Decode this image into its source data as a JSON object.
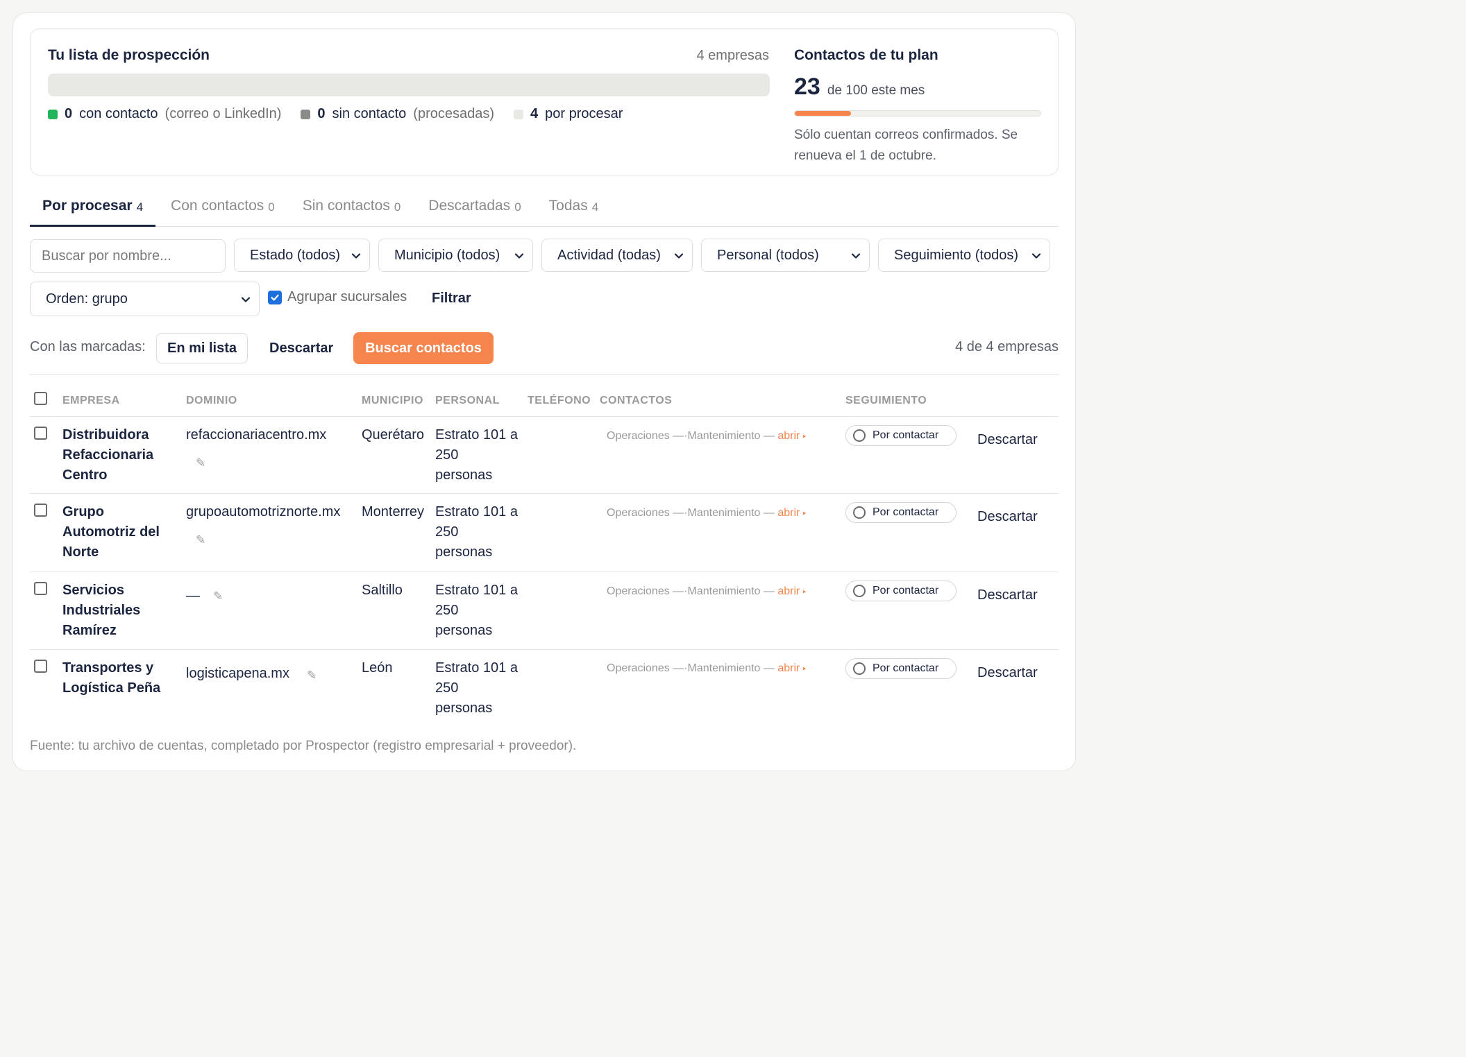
{
  "summary": {
    "title": "Tu lista de prospección",
    "count_text": "4 empresas",
    "progress_fraction": 0.0,
    "legend": [
      {
        "num": "0",
        "label": "con contacto",
        "note": "(correo o LinkedIn)",
        "color": "#22b55a"
      },
      {
        "num": "0",
        "label": "sin contacto",
        "note": "(procesadas)",
        "color": "#8a8a86"
      },
      {
        "num": "4",
        "label": "por procesar",
        "note": "",
        "color": "#e8e8e4"
      }
    ]
  },
  "plan": {
    "title": "Contactos de tu plan",
    "used": "23",
    "of_text": "de 100 este mes",
    "used_fraction": 0.23,
    "note": "Sólo cuentan correos confirmados. Se renueva el 1 de octubre."
  },
  "tabs": [
    {
      "label": "Por procesar",
      "count": "4",
      "active": true
    },
    {
      "label": "Con contactos",
      "count": "0",
      "active": false
    },
    {
      "label": "Sin contactos",
      "count": "0",
      "active": false
    },
    {
      "label": "Descartadas",
      "count": "0",
      "active": false
    },
    {
      "label": "Todas",
      "count": "4",
      "active": false
    }
  ],
  "filters": {
    "search_placeholder": "Buscar por nombre...",
    "estado": "Estado (todos)",
    "municipio": "Municipio (todos)",
    "actividad": "Actividad (todas)",
    "personal": "Personal (todos)",
    "seguimiento": "Seguimiento (todos)",
    "orden": "Orden: grupo",
    "agrupar_label": "Agrupar sucursales",
    "agrupar_checked": true,
    "filtrar_label": "Filtrar"
  },
  "bulk": {
    "label": "Con las marcadas:",
    "en_mi_lista": "En mi lista",
    "descartar": "Descartar",
    "buscar_contactos": "Buscar contactos",
    "result_count": "4 de 4 empresas"
  },
  "table": {
    "headers": {
      "empresa": "EMPRESA",
      "dominio": "DOMINIO",
      "municipio": "MUNICIPIO",
      "personal": "PERSONAL",
      "telefono": "TELÉFONO",
      "contactos": "CONTACTOS",
      "seguimiento": "SEGUIMIENTO"
    },
    "rows": [
      {
        "empresa": "Distribuidora Refaccionaria Centro",
        "dominio": "refaccionariacentro.mx",
        "municipio": "Querétaro",
        "personal": "Estrato 101 a 250 personas",
        "telefono": "",
        "contact_a": "Operaciones —",
        "contact_b": "Mantenimiento —",
        "abrir": "abrir",
        "seguimiento": "Por contactar",
        "descartar": "Descartar"
      },
      {
        "empresa": "Grupo Automotriz del Norte",
        "dominio": "grupoautomotriznorte.mx",
        "municipio": "Monterrey",
        "personal": "Estrato 101 a 250 personas",
        "telefono": "",
        "contact_a": "Operaciones —",
        "contact_b": "Mantenimiento —",
        "abrir": "abrir",
        "seguimiento": "Por contactar",
        "descartar": "Descartar"
      },
      {
        "empresa": "Servicios Industriales Ramírez",
        "dominio": "—",
        "municipio": "Saltillo",
        "personal": "Estrato 101 a 250 personas",
        "telefono": "",
        "contact_a": "Operaciones —",
        "contact_b": "Mantenimiento —",
        "abrir": "abrir",
        "seguimiento": "Por contactar",
        "descartar": "Descartar"
      },
      {
        "empresa": "Transportes y Logística Peña",
        "dominio": "logisticapena.mx",
        "municipio": "León",
        "personal": "Estrato 101 a 250 personas",
        "telefono": "",
        "contact_a": "Operaciones —",
        "contact_b": "Mantenimiento —",
        "abrir": "abrir",
        "seguimiento": "Por contactar",
        "descartar": "Descartar"
      }
    ]
  },
  "footer": "Fuente: tu archivo de cuentas, completado por Prospector (registro empresarial + proveedor).",
  "icons": {
    "edit": "pencil-icon",
    "dropdown": "chevron-down-icon",
    "status": "empty-circle-icon"
  }
}
